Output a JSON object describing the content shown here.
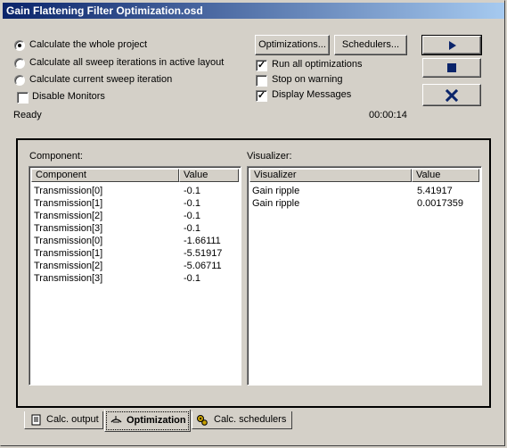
{
  "window": {
    "title": "Gain Flattening Filter Optimization.osd"
  },
  "options": {
    "radios": [
      {
        "label": "Calculate the whole project",
        "selected": true
      },
      {
        "label": "Calculate all sweep iterations in active layout",
        "selected": false
      },
      {
        "label": "Calculate current sweep iteration",
        "selected": false
      }
    ],
    "disable_monitors": {
      "label": "Disable Monitors",
      "checked": false
    }
  },
  "buttons": {
    "optimizations": "Optimizations...",
    "schedulers": "Schedulers...",
    "run_icon": "play-icon",
    "stop_icon": "stop-icon",
    "close_icon": "close-icon"
  },
  "checks": [
    {
      "label": "Run all optimizations",
      "checked": true
    },
    {
      "label": "Stop on warning",
      "checked": false
    },
    {
      "label": "Display Messages",
      "checked": true
    }
  ],
  "status": {
    "text": "Ready",
    "elapsed": "00:00:14"
  },
  "component_panel": {
    "caption": "Component:",
    "columns": [
      "Component",
      "Value"
    ],
    "rows": [
      [
        "Transmission[0]",
        "-0.1"
      ],
      [
        "Transmission[1]",
        "-0.1"
      ],
      [
        "Transmission[2]",
        "-0.1"
      ],
      [
        "Transmission[3]",
        "-0.1"
      ],
      [
        "Transmission[0]",
        "-1.66111"
      ],
      [
        "Transmission[1]",
        "-5.51917"
      ],
      [
        "Transmission[2]",
        "-5.06711"
      ],
      [
        "Transmission[3]",
        "-0.1"
      ]
    ]
  },
  "visualizer_panel": {
    "caption": "Visualizer:",
    "columns": [
      "Visualizer",
      "Value"
    ],
    "rows": [
      [
        "Gain ripple",
        "5.41917"
      ],
      [
        "Gain ripple",
        "0.0017359"
      ]
    ]
  },
  "tabs": [
    {
      "label": "Calc. output",
      "icon": "document-icon",
      "active": false
    },
    {
      "label": "Optimization",
      "icon": "optimization-icon",
      "active": true
    },
    {
      "label": "Calc. schedulers",
      "icon": "gears-icon",
      "active": false
    }
  ],
  "colors": {
    "title_start": "#0a246a",
    "title_end": "#a6caf0",
    "face": "#d4d0c8",
    "icon_blue": "#0a246a"
  }
}
